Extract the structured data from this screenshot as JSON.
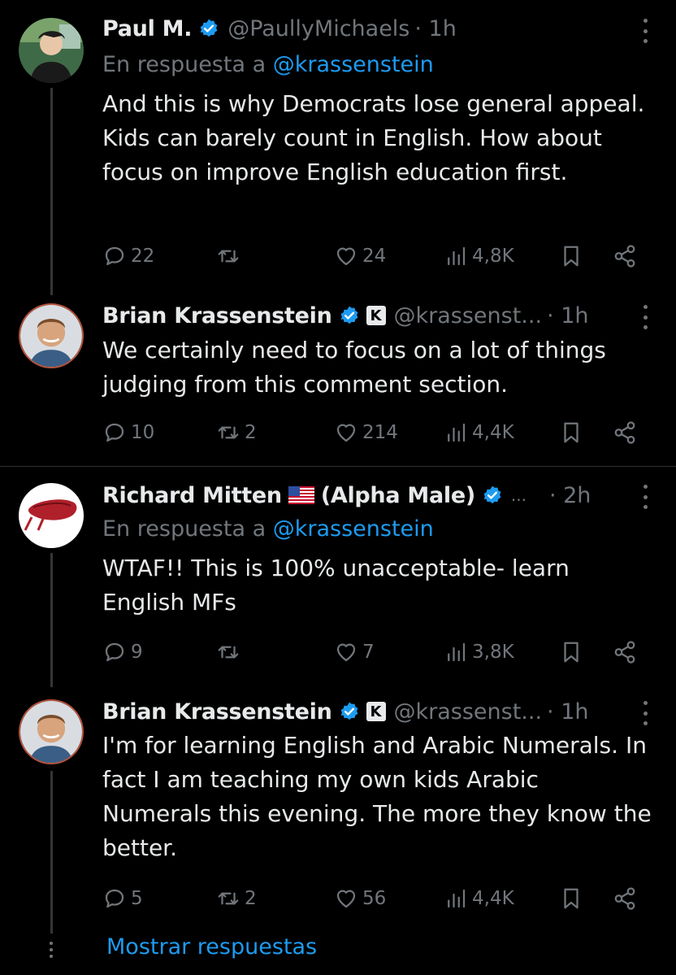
{
  "colors": {
    "background": "#000000",
    "text": "#e7e9ea",
    "muted": "#71767b",
    "accent": "#1d9bf0",
    "verified": "#1d9bf0"
  },
  "tweets": [
    {
      "name": "Paul M.",
      "handle": "@PaullyMichaels",
      "time": "· 1h",
      "reply_prefix": "En respuesta a",
      "reply_handle": "@krassenstein",
      "body": "And this is why Democrats lose general appeal.  Kids can barely count in English.  How about focus on improve English education first.",
      "replies": "22",
      "retweets": "",
      "likes": "24",
      "views": "4,8K"
    },
    {
      "name": "Brian Krassenstein",
      "handle": "@krassenst...",
      "time": "· 1h",
      "badge_letter": "K",
      "body": "We certainly need to focus on a lot of things judging from this comment section.",
      "replies": "10",
      "retweets": "2",
      "likes": "214",
      "views": "4,4K"
    },
    {
      "name": "Richard Mitten",
      "name_suffix": "(Alpha Male)",
      "ellipsis": "...",
      "time": "· 2h",
      "reply_prefix": "En respuesta a",
      "reply_handle": "@krassenstein",
      "body": "WTAF!!  This is 100% unacceptable- learn English MFs",
      "replies": "9",
      "retweets": "",
      "likes": "7",
      "views": "3,8K"
    },
    {
      "name": "Brian Krassenstein",
      "handle": "@krassenst...",
      "time": "· 1h",
      "badge_letter": "K",
      "body": "I'm for learning English and Arabic Numerals.  In fact I am teaching my own kids Arabic Numerals this evening.  The more they know the better.",
      "replies": "5",
      "retweets": "2",
      "likes": "56",
      "views": "4,4K"
    }
  ],
  "show_replies": "Mostrar respuestas",
  "icons": [
    "reply-icon",
    "retweet-icon",
    "like-icon",
    "views-icon",
    "bookmark-icon",
    "share-icon",
    "verified-icon",
    "more-icon",
    "flag-us-icon"
  ]
}
